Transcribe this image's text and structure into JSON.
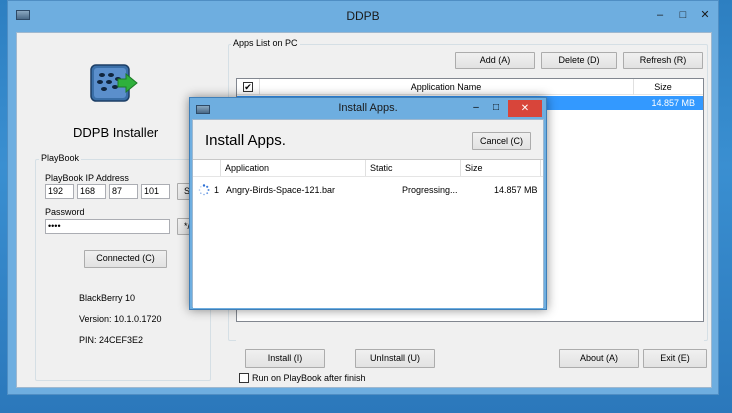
{
  "main_window": {
    "title": "DDPB",
    "controls": {
      "minimize": "–",
      "maximize": "□",
      "close": "✕"
    },
    "app_name": "DDPB Installer",
    "playbook": {
      "group_label": "PlayBook",
      "ip_label": "PlayBook IP Address",
      "ip_octets": [
        "192",
        "168",
        "87",
        "101"
      ],
      "scan_label": "Sca",
      "password_label": "Password",
      "password_value": "••••",
      "show_label": "*/\\",
      "connected_label": "Connected (C)",
      "device_name": "BlackBerry 10",
      "version": "Version: 10.1.0.1720",
      "pin": "PIN: 24CEF3E2"
    },
    "apps_list": {
      "group_label": "Apps List on PC",
      "add_label": "Add (A)",
      "delete_label": "Delete (D)",
      "refresh_label": "Refresh (R)",
      "col_name": "Application Name",
      "col_size": "Size",
      "selected_row_size": "14.857 MB"
    },
    "bottom": {
      "install_label": "Install (I)",
      "uninstall_label": "UnInstall (U)",
      "about_label": "About (A)",
      "exit_label": "Exit (E)",
      "run_after_label": "Run on PlayBook after finish"
    },
    "colors": {
      "selection": "#3399ff",
      "titlebar": "#6eaee0",
      "accent_green": "#2fb03c"
    }
  },
  "dialog": {
    "title": "Install Apps.",
    "heading": "Install Apps.",
    "cancel_label": "Cancel (C)",
    "controls": {
      "minimize": "–",
      "maximize": "□",
      "close": "✕"
    },
    "columns": [
      "Application",
      "Static",
      "Size"
    ],
    "rows": [
      {
        "index": "1",
        "application": "Angry-Birds-Space-121.bar",
        "static": "Progressing...",
        "size": "14.857 MB",
        "icon": "spinner-icon"
      }
    ]
  }
}
